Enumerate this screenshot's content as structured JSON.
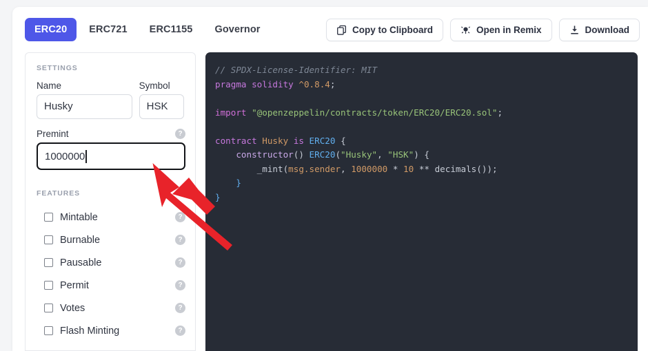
{
  "toolbar": {
    "tabs": [
      {
        "label": "ERC20",
        "active": true
      },
      {
        "label": "ERC721",
        "active": false
      },
      {
        "label": "ERC1155",
        "active": false
      },
      {
        "label": "Governor",
        "active": false
      }
    ],
    "actions": [
      {
        "label": "Copy to Clipboard",
        "icon": "copy-icon"
      },
      {
        "label": "Open in Remix",
        "icon": "remix-icon"
      },
      {
        "label": "Download",
        "icon": "download-icon"
      }
    ]
  },
  "sidebar": {
    "settings_title": "SETTINGS",
    "features_title": "FEATURES",
    "fields": {
      "name": {
        "label": "Name",
        "value": "Husky"
      },
      "symbol": {
        "label": "Symbol",
        "value": "HSK"
      },
      "premint": {
        "label": "Premint",
        "value": "1000000",
        "focused": true,
        "help": "?"
      }
    },
    "features": [
      {
        "label": "Mintable",
        "checked": false,
        "help": "?"
      },
      {
        "label": "Burnable",
        "checked": false,
        "help": "?"
      },
      {
        "label": "Pausable",
        "checked": false,
        "help": "?"
      },
      {
        "label": "Permit",
        "checked": false,
        "help": "?"
      },
      {
        "label": "Votes",
        "checked": false,
        "help": "?"
      },
      {
        "label": "Flash Minting",
        "checked": false,
        "help": "?"
      }
    ]
  },
  "code": {
    "language": "solidity",
    "lines": [
      "// SPDX-License-Identifier: MIT",
      "pragma solidity ^0.8.4;",
      "",
      "import \"@openzeppelin/contracts/token/ERC20/ERC20.sol\";",
      "",
      "contract Husky is ERC20 {",
      "    constructor() ERC20(\"Husky\", \"HSK\") {",
      "        _mint(msg.sender, 1000000 * 10 ** decimals());",
      "    }",
      "}"
    ]
  },
  "annotation": {
    "type": "red-arrow",
    "points_to": "premint-input"
  },
  "colors": {
    "accent": "#4e57e8",
    "code_bg": "#272c36",
    "arrow": "#e8232a",
    "page_bg": "#f4f5f7"
  }
}
